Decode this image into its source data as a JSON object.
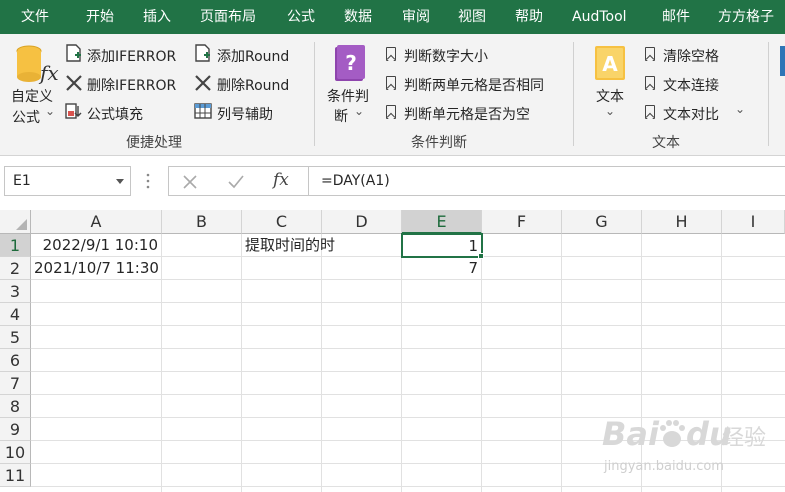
{
  "menubar": {
    "tabs": [
      "文件",
      "开始",
      "插入",
      "页面布局",
      "公式",
      "数据",
      "审阅",
      "视图",
      "帮助",
      "AudTool",
      "邮件",
      "方方格子"
    ]
  },
  "ribbon": {
    "custom_formula": {
      "line1": "自定义",
      "line2": "公式",
      "dropdown": "⌄"
    },
    "quick": {
      "add_iferror": "添加IFERROR",
      "del_iferror": "删除IFERROR",
      "formula_fill": "公式填充",
      "add_round": "添加Round",
      "del_round": "删除Round",
      "col_helper": "列号辅助",
      "group_label": "便捷处理"
    },
    "condition": {
      "big_line1": "条件判",
      "big_line2": "断",
      "compare_num": "判断数字大小",
      "two_cells_same": "判断两单元格是否相同",
      "cell_empty": "判断单元格是否为空",
      "group_label": "条件判断"
    },
    "text": {
      "big_label": "文本",
      "clear_spaces": "清除空格",
      "text_concat": "文本连接",
      "text_compare": "文本对比",
      "group_label": "文本"
    }
  },
  "formula_bar": {
    "name_box": "E1",
    "formula": "=DAY(A1)",
    "fx": "fx"
  },
  "grid": {
    "columns": [
      "A",
      "B",
      "C",
      "D",
      "E",
      "F",
      "G",
      "H",
      "I"
    ],
    "rows": [
      "1",
      "2",
      "3",
      "4",
      "5",
      "6",
      "7",
      "8",
      "9",
      "10",
      "11"
    ],
    "cells": {
      "A1": "2022/9/1 10:10",
      "A2": "2021/10/7 11:30",
      "C1": "提取时间的时",
      "E1": "1",
      "E2": "7"
    }
  },
  "watermark": {
    "brand": "Bai",
    "brand2": "du",
    "cn": "经验",
    "url": "jingyan.baidu.com"
  },
  "colors": {
    "accent": "#217346",
    "grid_line": "#e1e1e1"
  }
}
